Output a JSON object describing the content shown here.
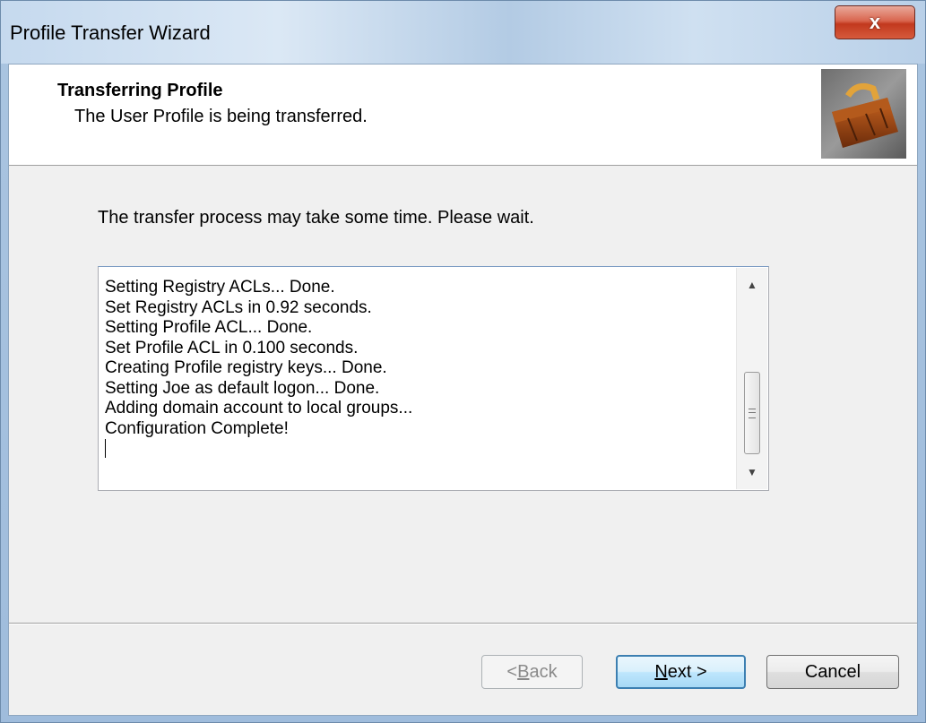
{
  "window": {
    "title": "Profile Transfer Wizard",
    "close_glyph": "x"
  },
  "header": {
    "title": "Transferring Profile",
    "subtitle": "The User Profile is being transferred.",
    "image_icon": "briefcase-icon"
  },
  "body": {
    "instruction": "The transfer process may take some time. Please wait."
  },
  "log": {
    "lines": [
      "Setting Registry ACLs... Done.",
      "Set Registry ACLs in 0.92 seconds.",
      "Setting Profile ACL... Done.",
      "Set Profile ACL in 0.100 seconds.",
      "Creating Profile registry keys... Done.",
      "Setting Joe as default logon... Done.",
      "Adding domain account to local groups...",
      "Configuration Complete!"
    ]
  },
  "buttons": {
    "back": {
      "prefix": "< ",
      "mnemonic": "B",
      "rest": "ack"
    },
    "next": {
      "mnemonic": "N",
      "rest": "ext >"
    },
    "cancel": "Cancel"
  },
  "colors": {
    "close_button": "#c7442a",
    "next_border": "#3c7fb1",
    "client_background": "#f0f0f0"
  }
}
